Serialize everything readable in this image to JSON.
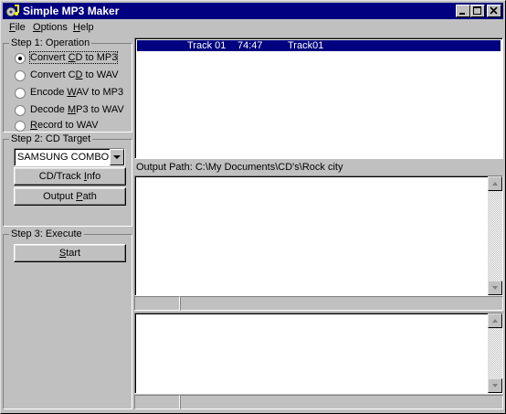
{
  "window": {
    "title": "Simple MP3 Maker"
  },
  "menu": [
    {
      "pre": "",
      "u": "F",
      "post": "ile"
    },
    {
      "pre": "",
      "u": "O",
      "post": "ptions"
    },
    {
      "pre": "",
      "u": "H",
      "post": "elp"
    }
  ],
  "step1": {
    "title": "Step 1: Operation",
    "options": [
      {
        "pre": "Convert ",
        "u": "C",
        "post": "D to MP3",
        "selected": true
      },
      {
        "pre": "Convert C",
        "u": "D",
        "post": " to WAV",
        "selected": false
      },
      {
        "pre": "Encode ",
        "u": "W",
        "post": "AV to MP3",
        "selected": false
      },
      {
        "pre": "Decode ",
        "u": "M",
        "post": "P3 to WAV",
        "selected": false
      },
      {
        "pre": "",
        "u": "R",
        "post": "ecord to WAV",
        "selected": false
      }
    ]
  },
  "step2": {
    "title": "Step 2: CD Target",
    "drive": "SAMSUNG COMBO SM",
    "cdinfo": {
      "pre": "CD/Track ",
      "u": "I",
      "post": "nfo"
    },
    "outpath": {
      "pre": "Output ",
      "u": "P",
      "post": "ath"
    }
  },
  "step3": {
    "title": "Step 3: Execute",
    "start": {
      "pre": "",
      "u": "S",
      "post": "tart"
    }
  },
  "tracks": [
    {
      "track": "Track 01",
      "time": "74:47",
      "name": "Track01",
      "selected": true
    }
  ],
  "output_path_label": "Output Path: C:\\My Documents\\CD's\\Rock city"
}
